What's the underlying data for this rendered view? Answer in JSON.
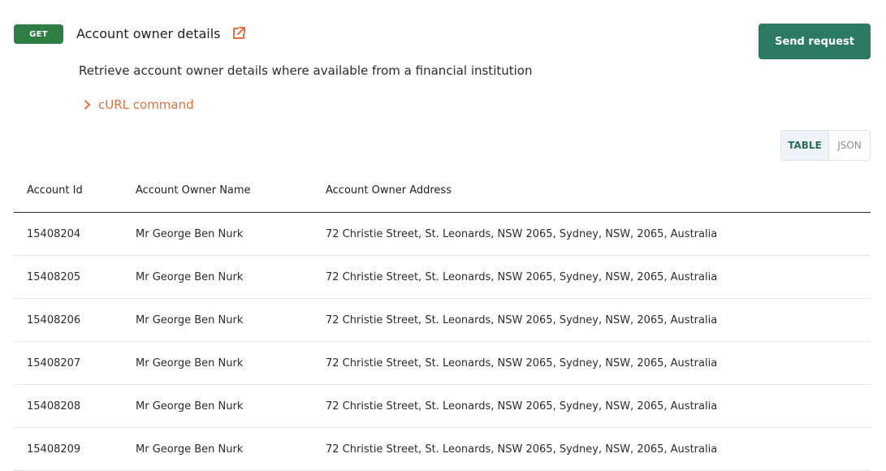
{
  "endpoint": {
    "method": "GET",
    "title": "Account owner details",
    "description": "Retrieve account owner details where available from a financial institution",
    "curl_label": "cURL command",
    "send_label": "Send request"
  },
  "view_toggle": {
    "table_label": "TABLE",
    "json_label": "JSON",
    "selected": "TABLE"
  },
  "colors": {
    "method_badge": "#2e7d43",
    "send_button": "#2d7a64",
    "link_accent": "#e0733d"
  },
  "table": {
    "headers": [
      "Account Id",
      "Account Owner Name",
      "Account Owner Address"
    ],
    "rows": [
      [
        "15408204",
        "Mr George Ben Nurk",
        "72 Christie Street, St. Leonards, NSW 2065, Sydney, NSW, 2065, Australia"
      ],
      [
        "15408205",
        "Mr George Ben Nurk",
        "72 Christie Street, St. Leonards, NSW 2065, Sydney, NSW, 2065, Australia"
      ],
      [
        "15408206",
        "Mr George Ben Nurk",
        "72 Christie Street, St. Leonards, NSW 2065, Sydney, NSW, 2065, Australia"
      ],
      [
        "15408207",
        "Mr George Ben Nurk",
        "72 Christie Street, St. Leonards, NSW 2065, Sydney, NSW, 2065, Australia"
      ],
      [
        "15408208",
        "Mr George Ben Nurk",
        "72 Christie Street, St. Leonards, NSW 2065, Sydney, NSW, 2065, Australia"
      ],
      [
        "15408209",
        "Mr George Ben Nurk",
        "72 Christie Street, St. Leonards, NSW 2065, Sydney, NSW, 2065, Australia"
      ]
    ]
  },
  "icons": {
    "external_link": "external-link-icon",
    "curl_expand": "chevron-right-icon"
  }
}
